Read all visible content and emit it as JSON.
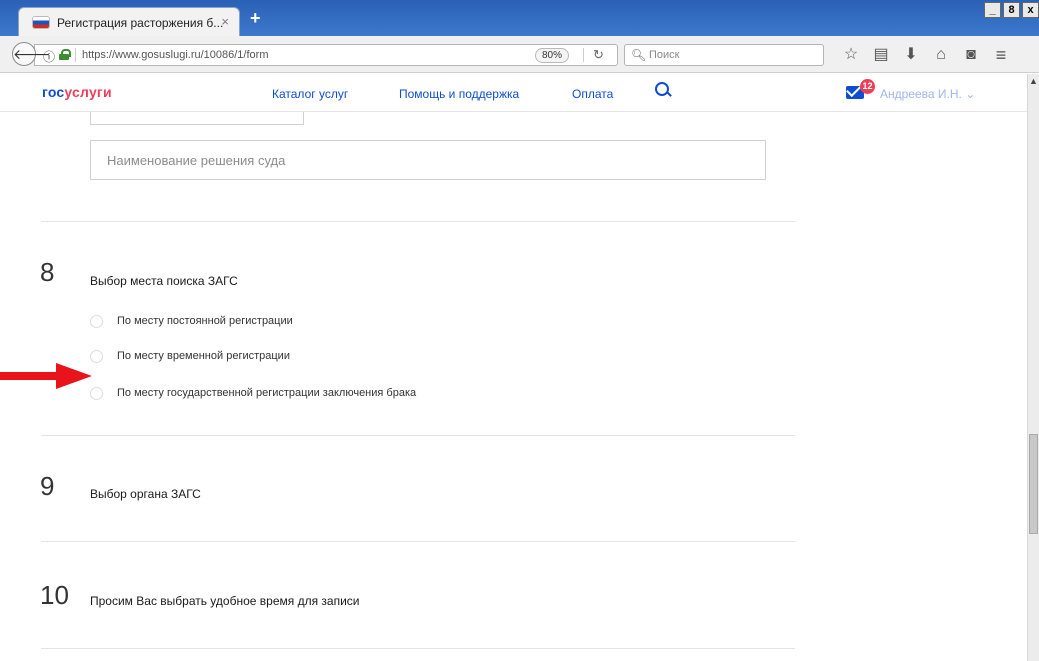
{
  "browser": {
    "tab_title": "Регистрация расторжения б...",
    "tab_close": "×",
    "new_tab": "+",
    "window_controls": [
      "_",
      "8",
      "x"
    ],
    "url": "https://www.gosuslugi.ru/10086/1/form",
    "zoom": "80%",
    "search_placeholder": "Поиск"
  },
  "site": {
    "logo_part1": "гос",
    "logo_part2": "услуги",
    "nav": [
      "Каталог услуг",
      "Помощь и поддержка",
      "Оплата"
    ],
    "mail_count": "12",
    "user_name": "Андреева И.Н."
  },
  "form": {
    "court_decision_placeholder": "Наименование решения суда",
    "sections": [
      {
        "number": "8",
        "title": "Выбор места поиска ЗАГС",
        "options": [
          "По месту постоянной регистрации",
          "По месту временной регистрации",
          "По месту государственной регистрации заключения брака"
        ]
      },
      {
        "number": "9",
        "title": "Выбор органа ЗАГС"
      },
      {
        "number": "10",
        "title": "Просим Вас выбрать удобное время для записи"
      }
    ]
  },
  "colors": {
    "brand_blue": "#0d4cd3",
    "brand_red": "#ee3f58",
    "arrow_red": "#e8131b",
    "titlebar": "#2a61b6"
  },
  "icons": [
    "back-icon",
    "info-icon",
    "lock-icon",
    "reload-icon",
    "search-icon",
    "bookmark-star-icon",
    "reading-list-icon",
    "download-icon",
    "home-icon",
    "pocket-icon",
    "menu-icon",
    "mail-icon",
    "chevron-down-icon",
    "red-arrow-icon"
  ]
}
